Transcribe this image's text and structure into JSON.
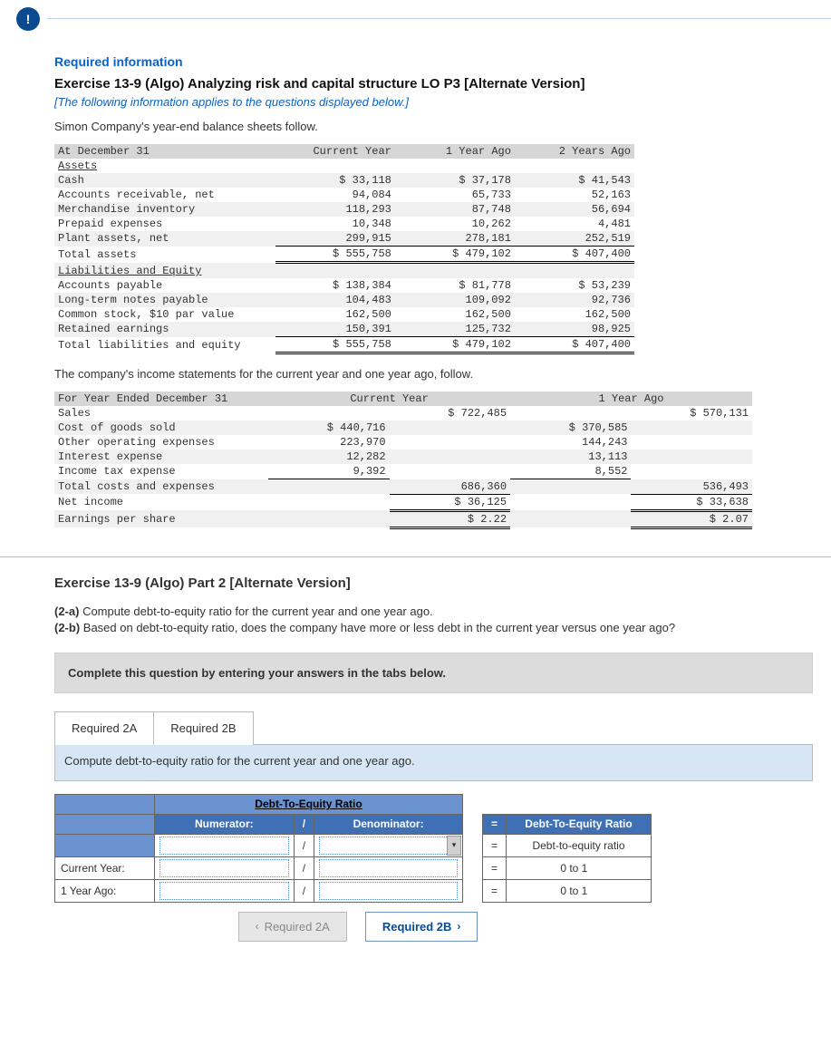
{
  "badge": "!",
  "required_info": "Required information",
  "exercise_title": "Exercise 13-9 (Algo) Analyzing risk and capital structure LO P3 [Alternate Version]",
  "italic_note": "[The following information applies to the questions displayed below.]",
  "intro_line": "Simon Company's year-end balance sheets follow.",
  "balance_sheet": {
    "header": {
      "r0c0": "At December 31",
      "r0c1": "Current Year",
      "r0c2": "1 Year Ago",
      "r0c3": "2 Years Ago"
    },
    "assets_label": "Assets",
    "rows_assets": [
      {
        "l": "Cash",
        "c1": "$ 33,118",
        "c2": "$ 37,178",
        "c3": "$ 41,543"
      },
      {
        "l": "Accounts receivable, net",
        "c1": "94,084",
        "c2": "65,733",
        "c3": "52,163"
      },
      {
        "l": "Merchandise inventory",
        "c1": "118,293",
        "c2": "87,748",
        "c3": "56,694"
      },
      {
        "l": "Prepaid expenses",
        "c1": "10,348",
        "c2": "10,262",
        "c3": "4,481"
      },
      {
        "l": "Plant assets, net",
        "c1": "299,915",
        "c2": "278,181",
        "c3": "252,519"
      }
    ],
    "total_assets": {
      "l": "Total assets",
      "c1": "$ 555,758",
      "c2": "$ 479,102",
      "c3": "$ 407,400"
    },
    "liab_label": "Liabilities and Equity",
    "rows_liab": [
      {
        "l": "Accounts payable",
        "c1": "$ 138,384",
        "c2": "$ 81,778",
        "c3": "$ 53,239"
      },
      {
        "l": "Long-term notes payable",
        "c1": "104,483",
        "c2": "109,092",
        "c3": "92,736"
      },
      {
        "l": "Common stock, $10 par value",
        "c1": "162,500",
        "c2": "162,500",
        "c3": "162,500"
      },
      {
        "l": "Retained earnings",
        "c1": "150,391",
        "c2": "125,732",
        "c3": "98,925"
      }
    ],
    "total_liab": {
      "l": "Total liabilities and equity",
      "c1": "$ 555,758",
      "c2": "$ 479,102",
      "c3": "$ 407,400"
    }
  },
  "income_intro": "The company's income statements for the current year and one year ago, follow.",
  "income": {
    "header": {
      "r0c0": "For Year Ended December 31",
      "r0c1": "Current Year",
      "r0c2": "1 Year Ago"
    },
    "sales": {
      "l": "Sales",
      "c1b": "$ 722,485",
      "c2b": "$ 570,131"
    },
    "exp": [
      {
        "l": "Cost of goods sold",
        "c1a": "$ 440,716",
        "c2a": "$ 370,585"
      },
      {
        "l": "Other operating expenses",
        "c1a": "223,970",
        "c2a": "144,243"
      },
      {
        "l": "Interest expense",
        "c1a": "12,282",
        "c2a": "13,113"
      },
      {
        "l": "Income tax expense",
        "c1a": "9,392",
        "c2a": "8,552"
      }
    ],
    "total_exp": {
      "l": "Total costs and expenses",
      "c1b": "686,360",
      "c2b": "536,493"
    },
    "net_income": {
      "l": "Net income",
      "c1b": "$ 36,125",
      "c2b": "$ 33,638"
    },
    "eps": {
      "l": "Earnings per share",
      "c1b": "$ 2.22",
      "c2b": "$ 2.07"
    }
  },
  "part2_title": "Exercise 13-9 (Algo) Part 2 [Alternate Version]",
  "q2a_label": "(2-a)",
  "q2a_text": " Compute debt-to-equity ratio for the current year and one year ago.",
  "q2b_label": "(2-b)",
  "q2b_text": " Based on debt-to-equity ratio, does the company have more or less debt in the current year versus one year ago?",
  "complete_bar": "Complete this question by entering your answers in the tabs below.",
  "tabs": {
    "a": "Required 2A",
    "b": "Required 2B"
  },
  "panel_text": "Compute debt-to-equity ratio for the current year and one year ago.",
  "ans": {
    "title": "Debt-To-Equity Ratio",
    "numerator": "Numerator:",
    "slash": "/",
    "denominator": "Denominator:",
    "eq": "=",
    "ratio_hdr": "Debt-To-Equity Ratio",
    "ratio_row": "Debt-to-equity ratio",
    "cy": "Current Year:",
    "ya": "1 Year Ago:",
    "zero": "0",
    "to1": "to 1"
  },
  "nav": {
    "prev": "Required 2A",
    "next": "Required 2B"
  }
}
